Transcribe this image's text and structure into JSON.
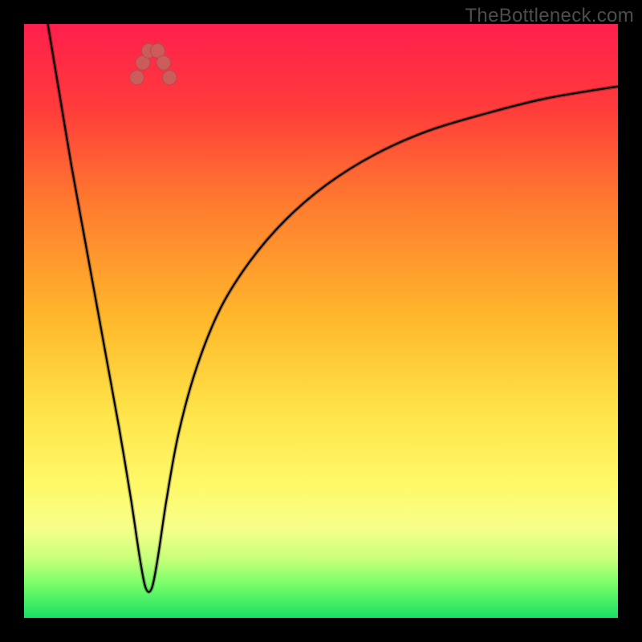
{
  "watermark": "TheBottleneck.com",
  "chart_data": {
    "type": "line",
    "title": "",
    "xlabel": "",
    "ylabel": "",
    "xlim": [
      0,
      100
    ],
    "ylim": [
      0,
      100
    ],
    "gradient_stops": [
      {
        "pct": 0,
        "color": "#ff1f4d"
      },
      {
        "pct": 14,
        "color": "#ff3b3b"
      },
      {
        "pct": 30,
        "color": "#ff7a2f"
      },
      {
        "pct": 50,
        "color": "#ffb92b"
      },
      {
        "pct": 66,
        "color": "#ffe54a"
      },
      {
        "pct": 78,
        "color": "#fff96a"
      },
      {
        "pct": 85,
        "color": "#f6ff8a"
      },
      {
        "pct": 90,
        "color": "#c8ff7a"
      },
      {
        "pct": 94,
        "color": "#7dff6a"
      },
      {
        "pct": 100,
        "color": "#18e060"
      }
    ],
    "curve": {
      "x": [
        4,
        6,
        8,
        10,
        12,
        14,
        16,
        18,
        19.5,
        20.5,
        21.5,
        22.5,
        24,
        26,
        29,
        33,
        38,
        44,
        51,
        59,
        68,
        78,
        88,
        100
      ],
      "y": [
        100,
        88,
        76,
        65,
        54,
        43,
        32,
        20,
        10,
        5,
        5,
        10,
        20,
        31,
        42,
        52,
        60,
        67,
        73,
        78,
        82,
        85,
        87.5,
        89.5
      ]
    },
    "markers": [
      {
        "x": 19.0,
        "y": 91.0,
        "r": 9
      },
      {
        "x": 20.0,
        "y": 93.5,
        "r": 9
      },
      {
        "x": 21.0,
        "y": 95.5,
        "r": 9
      },
      {
        "x": 22.5,
        "y": 95.5,
        "r": 9
      },
      {
        "x": 23.5,
        "y": 93.5,
        "r": 9
      },
      {
        "x": 24.5,
        "y": 91.0,
        "r": 9
      }
    ]
  }
}
